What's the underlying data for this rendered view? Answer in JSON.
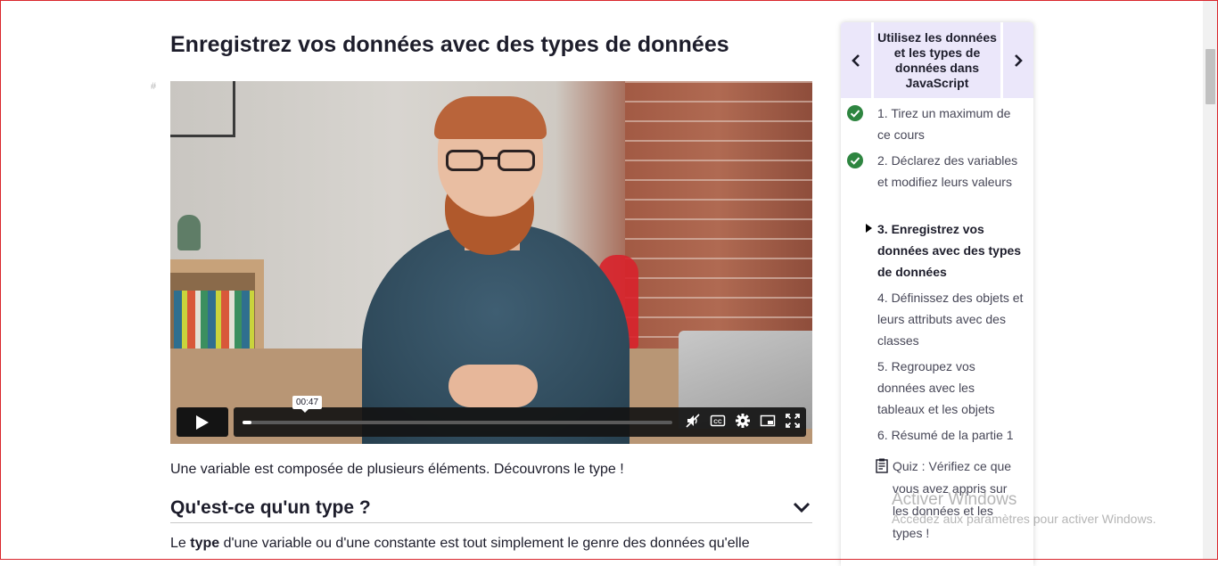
{
  "page": {
    "title": "Enregistrez vos données avec des types de données",
    "anchor_symbol": "#"
  },
  "video": {
    "timestamp": "00:47",
    "progress_fraction": 0.02,
    "controls": {
      "play": "play-icon",
      "mute": "mute-icon",
      "captions": "CC",
      "settings": "gear-icon",
      "pip": "picture-in-picture-icon",
      "fullscreen": "fullscreen-icon"
    }
  },
  "content": {
    "intro": "Une variable est composée de plusieurs éléments. Découvrons le type !",
    "section_title": "Qu'est-ce qu'un type ?",
    "para_prefix": "Le ",
    "para_bold": "type",
    "para_rest": " d'une variable ou d'une constante est tout simplement le genre des données qu'elle"
  },
  "sidebar": {
    "title": "Utilisez les données et les types de données dans JavaScript",
    "items": [
      {
        "label": "1. Tirez un maximum de ce cours",
        "status": "done"
      },
      {
        "label": "2. Déclarez des variables et modifiez leurs valeurs",
        "status": "done"
      },
      {
        "label": "3. Enregistrez vos données avec des types de données",
        "status": "current"
      },
      {
        "label": "4. Définissez des objets et leurs attributs avec des classes",
        "status": "todo"
      },
      {
        "label": "5. Regroupez vos données avec les tableaux et les objets",
        "status": "todo"
      },
      {
        "label": "6. Résumé de la partie 1",
        "status": "todo"
      },
      {
        "label": "Quiz : Vérifiez ce que vous avez appris sur les données et les types !",
        "status": "quiz"
      }
    ]
  },
  "watermark": {
    "title": "Activer Windows",
    "subtitle": "Accédez aux paramètres pour activer Windows."
  },
  "colors": {
    "accent_light": "#ebe7fa",
    "done_green": "#2e8540",
    "text": "#1d1d2b"
  }
}
